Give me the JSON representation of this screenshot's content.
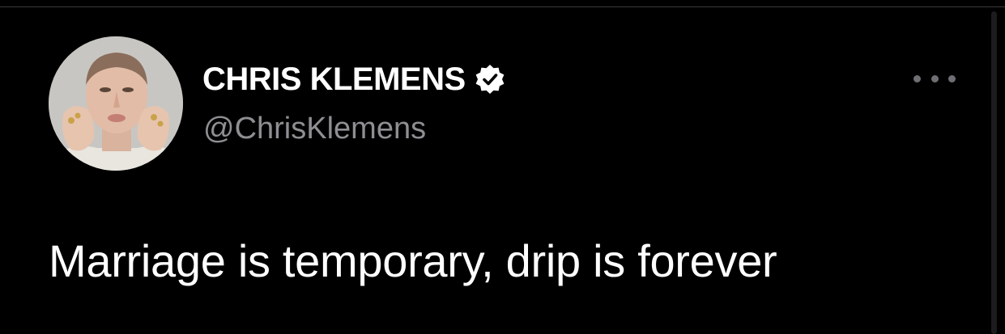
{
  "tweet": {
    "author": {
      "display_name": "CHRIS KLEMENS",
      "handle": "@ChrisKlemens",
      "verified": true,
      "avatar_icon": "profile-photo"
    },
    "text": "Marriage is temporary, drip is forever",
    "more_icon": "ellipsis-icon"
  },
  "colors": {
    "background": "#000000",
    "primary_text": "#ffffff",
    "secondary_text": "#8e8e93",
    "badge": "#ffffff"
  }
}
